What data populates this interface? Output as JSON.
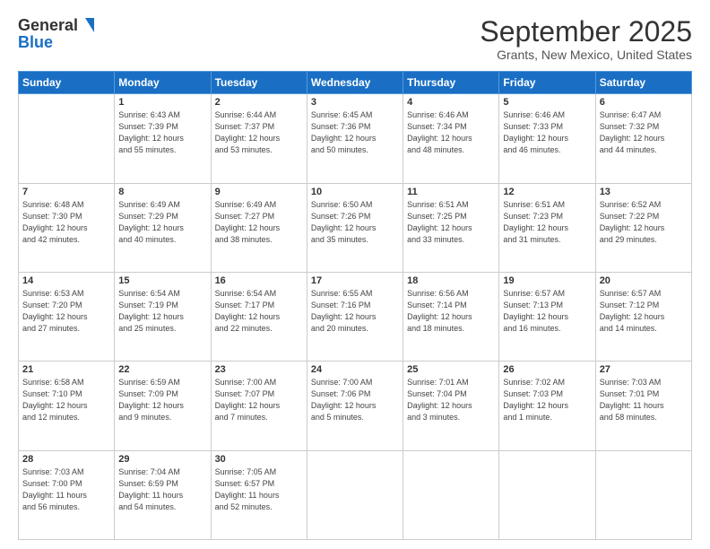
{
  "header": {
    "logo_general": "General",
    "logo_blue": "Blue",
    "title": "September 2025",
    "location": "Grants, New Mexico, United States"
  },
  "weekdays": [
    "Sunday",
    "Monday",
    "Tuesday",
    "Wednesday",
    "Thursday",
    "Friday",
    "Saturday"
  ],
  "weeks": [
    [
      {
        "day": "",
        "info": ""
      },
      {
        "day": "1",
        "info": "Sunrise: 6:43 AM\nSunset: 7:39 PM\nDaylight: 12 hours\nand 55 minutes."
      },
      {
        "day": "2",
        "info": "Sunrise: 6:44 AM\nSunset: 7:37 PM\nDaylight: 12 hours\nand 53 minutes."
      },
      {
        "day": "3",
        "info": "Sunrise: 6:45 AM\nSunset: 7:36 PM\nDaylight: 12 hours\nand 50 minutes."
      },
      {
        "day": "4",
        "info": "Sunrise: 6:46 AM\nSunset: 7:34 PM\nDaylight: 12 hours\nand 48 minutes."
      },
      {
        "day": "5",
        "info": "Sunrise: 6:46 AM\nSunset: 7:33 PM\nDaylight: 12 hours\nand 46 minutes."
      },
      {
        "day": "6",
        "info": "Sunrise: 6:47 AM\nSunset: 7:32 PM\nDaylight: 12 hours\nand 44 minutes."
      }
    ],
    [
      {
        "day": "7",
        "info": "Sunrise: 6:48 AM\nSunset: 7:30 PM\nDaylight: 12 hours\nand 42 minutes."
      },
      {
        "day": "8",
        "info": "Sunrise: 6:49 AM\nSunset: 7:29 PM\nDaylight: 12 hours\nand 40 minutes."
      },
      {
        "day": "9",
        "info": "Sunrise: 6:49 AM\nSunset: 7:27 PM\nDaylight: 12 hours\nand 38 minutes."
      },
      {
        "day": "10",
        "info": "Sunrise: 6:50 AM\nSunset: 7:26 PM\nDaylight: 12 hours\nand 35 minutes."
      },
      {
        "day": "11",
        "info": "Sunrise: 6:51 AM\nSunset: 7:25 PM\nDaylight: 12 hours\nand 33 minutes."
      },
      {
        "day": "12",
        "info": "Sunrise: 6:51 AM\nSunset: 7:23 PM\nDaylight: 12 hours\nand 31 minutes."
      },
      {
        "day": "13",
        "info": "Sunrise: 6:52 AM\nSunset: 7:22 PM\nDaylight: 12 hours\nand 29 minutes."
      }
    ],
    [
      {
        "day": "14",
        "info": "Sunrise: 6:53 AM\nSunset: 7:20 PM\nDaylight: 12 hours\nand 27 minutes."
      },
      {
        "day": "15",
        "info": "Sunrise: 6:54 AM\nSunset: 7:19 PM\nDaylight: 12 hours\nand 25 minutes."
      },
      {
        "day": "16",
        "info": "Sunrise: 6:54 AM\nSunset: 7:17 PM\nDaylight: 12 hours\nand 22 minutes."
      },
      {
        "day": "17",
        "info": "Sunrise: 6:55 AM\nSunset: 7:16 PM\nDaylight: 12 hours\nand 20 minutes."
      },
      {
        "day": "18",
        "info": "Sunrise: 6:56 AM\nSunset: 7:14 PM\nDaylight: 12 hours\nand 18 minutes."
      },
      {
        "day": "19",
        "info": "Sunrise: 6:57 AM\nSunset: 7:13 PM\nDaylight: 12 hours\nand 16 minutes."
      },
      {
        "day": "20",
        "info": "Sunrise: 6:57 AM\nSunset: 7:12 PM\nDaylight: 12 hours\nand 14 minutes."
      }
    ],
    [
      {
        "day": "21",
        "info": "Sunrise: 6:58 AM\nSunset: 7:10 PM\nDaylight: 12 hours\nand 12 minutes."
      },
      {
        "day": "22",
        "info": "Sunrise: 6:59 AM\nSunset: 7:09 PM\nDaylight: 12 hours\nand 9 minutes."
      },
      {
        "day": "23",
        "info": "Sunrise: 7:00 AM\nSunset: 7:07 PM\nDaylight: 12 hours\nand 7 minutes."
      },
      {
        "day": "24",
        "info": "Sunrise: 7:00 AM\nSunset: 7:06 PM\nDaylight: 12 hours\nand 5 minutes."
      },
      {
        "day": "25",
        "info": "Sunrise: 7:01 AM\nSunset: 7:04 PM\nDaylight: 12 hours\nand 3 minutes."
      },
      {
        "day": "26",
        "info": "Sunrise: 7:02 AM\nSunset: 7:03 PM\nDaylight: 12 hours\nand 1 minute."
      },
      {
        "day": "27",
        "info": "Sunrise: 7:03 AM\nSunset: 7:01 PM\nDaylight: 11 hours\nand 58 minutes."
      }
    ],
    [
      {
        "day": "28",
        "info": "Sunrise: 7:03 AM\nSunset: 7:00 PM\nDaylight: 11 hours\nand 56 minutes."
      },
      {
        "day": "29",
        "info": "Sunrise: 7:04 AM\nSunset: 6:59 PM\nDaylight: 11 hours\nand 54 minutes."
      },
      {
        "day": "30",
        "info": "Sunrise: 7:05 AM\nSunset: 6:57 PM\nDaylight: 11 hours\nand 52 minutes."
      },
      {
        "day": "",
        "info": ""
      },
      {
        "day": "",
        "info": ""
      },
      {
        "day": "",
        "info": ""
      },
      {
        "day": "",
        "info": ""
      }
    ]
  ]
}
